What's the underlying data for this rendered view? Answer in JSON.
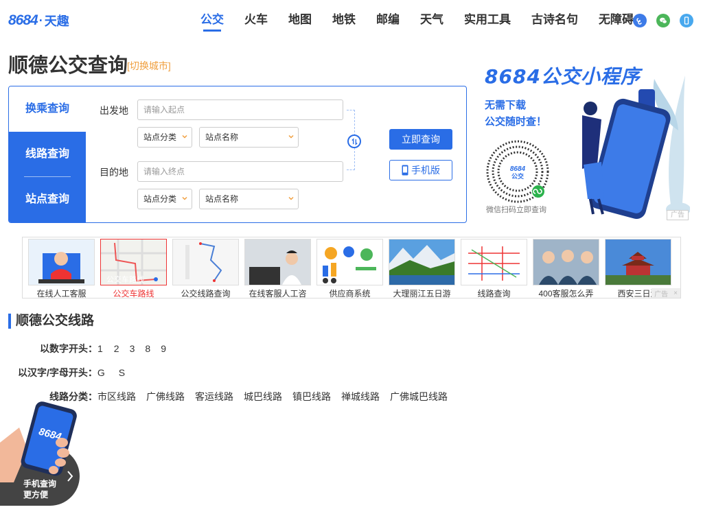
{
  "header": {
    "logo_main": "8684",
    "logo_dot": "·",
    "logo_sub": "天趣",
    "nav": [
      "公交",
      "火车",
      "地图",
      "地铁",
      "邮编",
      "天气",
      "实用工具",
      "古诗名句",
      "无障碍"
    ],
    "icons": [
      "mini-program-icon",
      "wechat-icon",
      "mobile-icon"
    ],
    "colors": {
      "accent": "#2a6de6",
      "mini": "#3d7be8",
      "wechat": "#4cb65a",
      "mobile": "#48a8ee"
    }
  },
  "page": {
    "title": "顺德公交查询",
    "switch_city": "[切换城市]"
  },
  "query": {
    "tabs": {
      "transfer": "换乘查询",
      "line": "线路查询",
      "stop": "站点查询"
    },
    "from_label": "出发地",
    "from_placeholder": "请输入起点",
    "to_label": "目的地",
    "to_placeholder": "请输入终点",
    "category_select": "站点分类",
    "name_select": "站点名称",
    "submit": "立即查询",
    "mobile": "手机版"
  },
  "ad": {
    "title": "8684公交小程序",
    "slogan1": "无需下载",
    "slogan2": "公交随时查！",
    "caption": "微信扫码立即查询",
    "qr_text": "8684",
    "qr_sub": "公交",
    "tag": "广告"
  },
  "strip": {
    "items": [
      "在线人工客服",
      "公交车路线",
      "公交线路查询",
      "在线客服人工咨",
      "供应商系统",
      "大理丽江五日游",
      "线路查询",
      "400客服怎么弄",
      "西安三日游"
    ],
    "map_label": "公交车路线",
    "close_tag": "广告",
    "close": "×"
  },
  "lines": {
    "section_title": "顺德公交线路",
    "digit_label": "以数字开头：",
    "digits": [
      "1",
      "2",
      "3",
      "8",
      "9"
    ],
    "letter_label": "以汉字/字母开头：",
    "letters": [
      "G",
      "S"
    ],
    "cat_label": "线路分类：",
    "categories": [
      "市区线路",
      "广佛线路",
      "客运线路",
      "城巴线路",
      "镇巴线路",
      "禅城线路",
      "广佛城巴线路"
    ]
  },
  "float": {
    "line1": "手机查询",
    "line2": "更方便",
    "phone_logo": "8684"
  }
}
